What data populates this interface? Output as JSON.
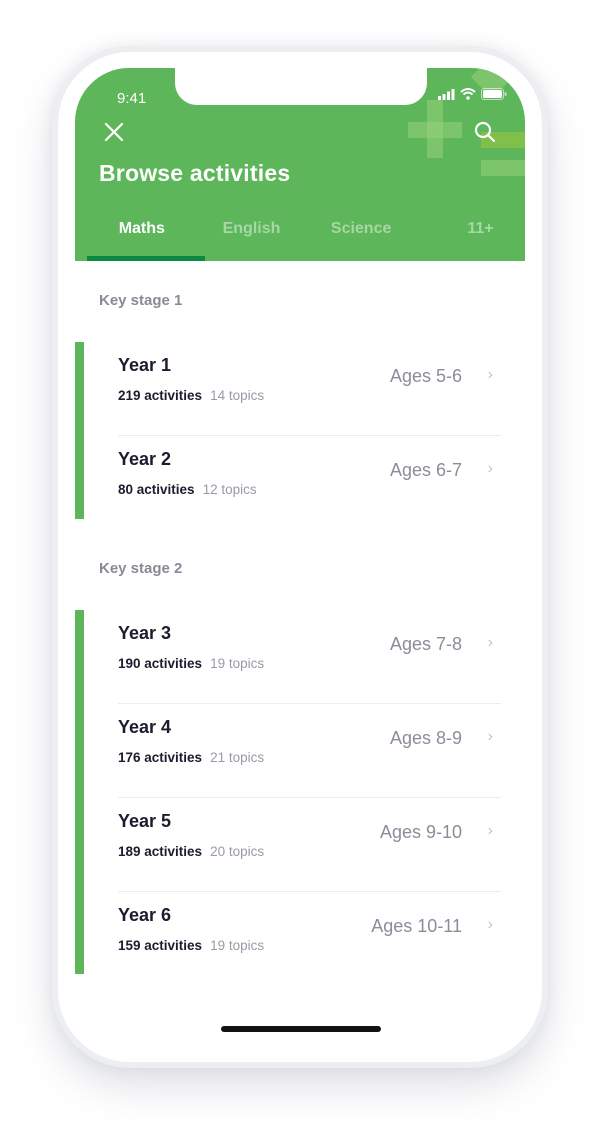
{
  "status_bar": {
    "time": "9:41",
    "icons": [
      "signal-icon",
      "wifi-icon",
      "battery-icon"
    ]
  },
  "header": {
    "title": "Browse activities",
    "close_icon": "close-icon",
    "search_icon": "search-icon",
    "background_color": "#5db65a",
    "accent_color": "#0a8a40"
  },
  "tabs": [
    {
      "label": "Maths",
      "active": true
    },
    {
      "label": "English",
      "active": false
    },
    {
      "label": "Science",
      "active": false
    },
    {
      "label": "11+",
      "active": false
    }
  ],
  "sections": [
    {
      "label": "Key stage 1",
      "items": [
        {
          "title": "Year 1",
          "activities": "219 activities",
          "topics": "14 topics",
          "ages": "Ages 5-6"
        },
        {
          "title": "Year 2",
          "activities": "80 activities",
          "topics": "12 topics",
          "ages": "Ages 6-7"
        }
      ]
    },
    {
      "label": "Key stage 2",
      "items": [
        {
          "title": "Year 3",
          "activities": "190 activities",
          "topics": "19 topics",
          "ages": "Ages 7-8"
        },
        {
          "title": "Year 4",
          "activities": "176 activities",
          "topics": "21 topics",
          "ages": "Ages 8-9"
        },
        {
          "title": "Year 5",
          "activities": "189 activities",
          "topics": "20 topics",
          "ages": "Ages 9-10"
        },
        {
          "title": "Year 6",
          "activities": "159 activities",
          "topics": "19 topics",
          "ages": "Ages 10-11"
        }
      ]
    }
  ],
  "chevron_glyph": "›"
}
